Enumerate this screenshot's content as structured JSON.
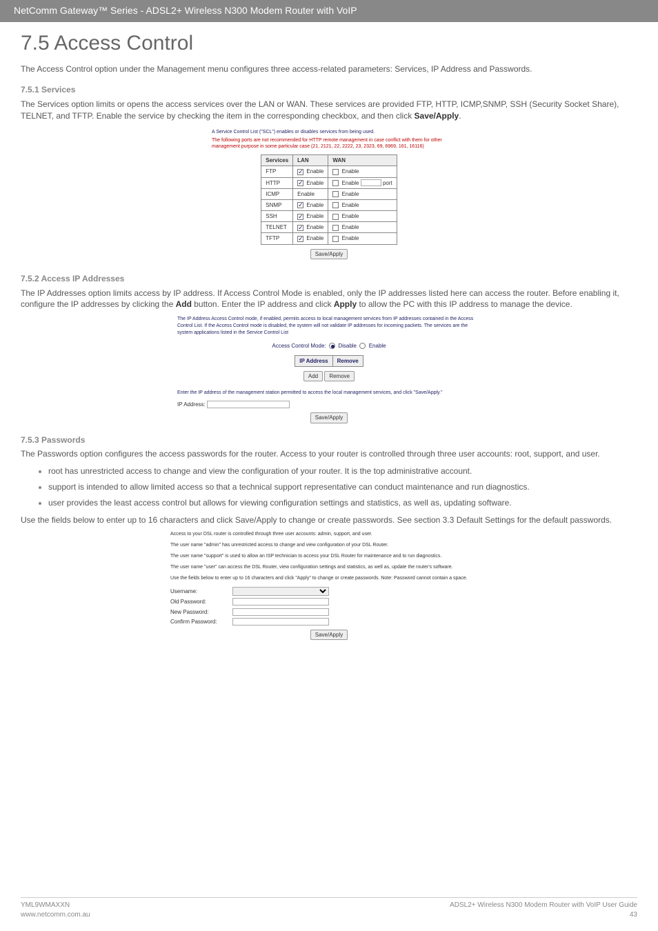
{
  "header": {
    "title": "NetComm Gateway™ Series - ADSL2+ Wireless N300 Modem Router with VoIP"
  },
  "section": {
    "title": "7.5 Access Control",
    "intro": "The Access Control option under the Management menu configures three access-related parameters:  Services, IP Address and Passwords."
  },
  "services": {
    "heading": "7.5.1    Services",
    "text_pre": "The Services option limits or opens the access services over the LAN or WAN.  These services are provided FTP, HTTP, ICMP,SNMP, SSH (Security Socket Share), TELNET, and TFTP.  Enable the service by checking the item in the corresponding checkbox, and then click ",
    "text_bold": "Save/Apply",
    "text_post": ".",
    "sc": {
      "line1": "A Service Control List (\"SCL\") enables or disables services from being used.",
      "line2": "The following ports are not recommended for HTTP remote management in case conflict with them for other management purpose in some particular case (21, 2121, 22, 2222, 23, 2323, 69, 6969, 161, 16116)",
      "th_services": "Services",
      "th_lan": "LAN",
      "th_wan": "WAN",
      "enable": "Enable",
      "port": "port",
      "rows": [
        "FTP",
        "HTTP",
        "ICMP",
        "SNMP",
        "SSH",
        "TELNET",
        "TFTP"
      ],
      "save": "Save/Apply"
    }
  },
  "ipaddr": {
    "heading": "7.5.2    Access IP Addresses",
    "text_pre": "The IP Addresses option limits access by IP address.  If Access Control Mode is enabled, only the IP addresses listed here can access the router.  Before enabling it, configure the IP addresses by clicking the ",
    "text_bold1": "Add",
    "text_mid": " button.  Enter the IP address and click ",
    "text_bold2": "Apply",
    "text_post": " to allow the PC with this IP address to manage the device.",
    "sc": {
      "note": "The IP Address Access Control mode, if enabled, permits access to local management services from IP addresses contained in the Access Control List. If the Access Control mode is disabled, the system will not validate IP addresses for incoming packets. The services are the system applications listed in the Service Control List",
      "mode_label": "Access Control Mode:",
      "disable": "Disable",
      "enable": "Enable",
      "th_ip": "IP Address",
      "th_remove": "Remove",
      "add": "Add",
      "remove": "Remove",
      "instr": "Enter the IP address of the management station permitted to access the local management services, and click \"Save/Apply.\"",
      "field": "IP Address:",
      "save": "Save/Apply"
    }
  },
  "passwords": {
    "heading": "7.5.3    Passwords",
    "intro": "The Passwords option configures the access passwords for the router.  Access to your router is controlled through three user accounts: root, support, and user.",
    "bullets": [
      "root has unrestricted access to change and view the configuration of your router.  It is the top administrative account.",
      "support is intended to allow limited access so that a technical support representative can conduct maintenance and run diagnostics.",
      "user provides the least access control but allows for viewing configuration settings and statistics, as well as, updating software."
    ],
    "outro": "Use the fields below to enter up to 16 characters and click Save/Apply to change or create passwords.  See section 3.3 Default Settings for the default passwords.",
    "sc": {
      "l1": "Access to your DSL router is controlled through three user accounts: admin, support, and user.",
      "l2": "The user name \"admin\" has unrestricted access to change and view configuration of your DSL Router.",
      "l3": "The user name \"support\" is used to allow an ISP technician to access your DSL Router for maintenance and to run diagnostics.",
      "l4": "The user name \"user\" can access the DSL Router, view configuration settings and statistics, as well as, update the router's software.",
      "l5": "Use the fields below to enter up to 16 characters and click \"Apply\" to change or create passwords. Note: Password cannot contain a space.",
      "username": "Username:",
      "old": "Old Password:",
      "new": "New Password:",
      "confirm": "Confirm Password:",
      "save": "Save/Apply"
    }
  },
  "footer": {
    "left1": "YML9WMAXXN",
    "left2": "www.netcomm.com.au",
    "right1": "ADSL2+ Wireless N300 Modem Router with VoIP User Guide",
    "right2": "43"
  }
}
